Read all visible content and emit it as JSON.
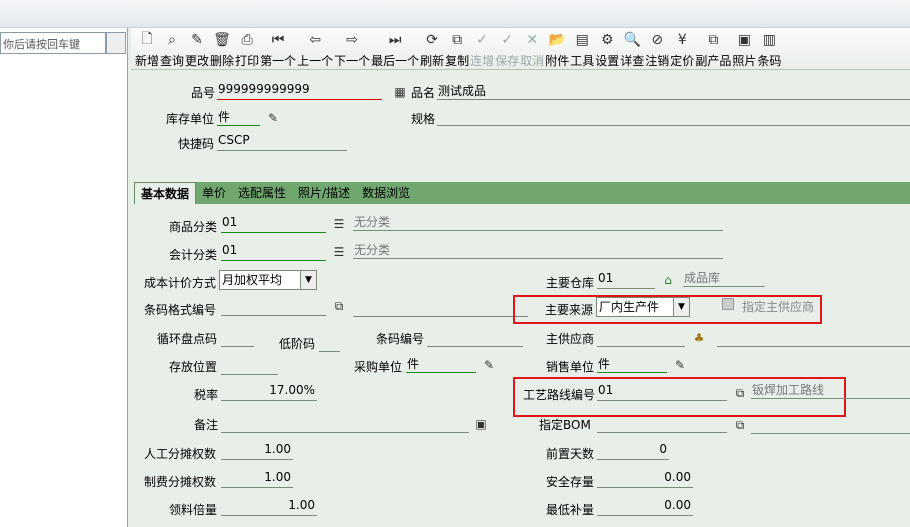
{
  "left_panel": {
    "search_placeholder": "你后请按回车键"
  },
  "toolbar": [
    {
      "label": "新增",
      "icon": "new-doc-icon",
      "glyph": "🗋"
    },
    {
      "label": "查询",
      "icon": "search-icon",
      "glyph": "⌕"
    },
    {
      "label": "更改",
      "icon": "pencil-icon",
      "glyph": "✎"
    },
    {
      "label": "删除",
      "icon": "trash-icon",
      "glyph": "🗑"
    },
    {
      "label": "打印",
      "icon": "printer-icon",
      "glyph": "⎙"
    },
    {
      "label": "第一个",
      "icon": "first-icon",
      "glyph": "⏮"
    },
    {
      "label": "上一个",
      "icon": "prev-icon",
      "glyph": "⇦"
    },
    {
      "label": "下一个",
      "icon": "next-icon",
      "glyph": "⇨"
    },
    {
      "label": "最后一个",
      "icon": "last-icon",
      "glyph": "⏭"
    },
    {
      "label": "刷新",
      "icon": "refresh-icon",
      "glyph": "⟳"
    },
    {
      "label": "复制",
      "icon": "copy-icon",
      "glyph": "⧉"
    },
    {
      "label": "连增",
      "icon": "continuous-add-icon",
      "glyph": "✓",
      "disabled": true
    },
    {
      "label": "保存",
      "icon": "save-icon",
      "glyph": "✓",
      "disabled": true
    },
    {
      "label": "取消",
      "icon": "cancel-icon",
      "glyph": "✕",
      "disabled": true
    },
    {
      "label": "附件",
      "icon": "folder-icon",
      "glyph": "📂"
    },
    {
      "label": "工具",
      "icon": "tools-icon",
      "glyph": "▤"
    },
    {
      "label": "设置",
      "icon": "gear-icon",
      "glyph": "⚙"
    },
    {
      "label": "详查",
      "icon": "detail-icon",
      "glyph": "🔍"
    },
    {
      "label": "注销",
      "icon": "logout-icon",
      "glyph": "⊘"
    },
    {
      "label": "定价",
      "icon": "price-icon",
      "glyph": "¥"
    },
    {
      "label": "副产品",
      "icon": "byproduct-icon",
      "glyph": "⧉"
    },
    {
      "label": "照片",
      "icon": "photo-icon",
      "glyph": "▣"
    },
    {
      "label": "条码",
      "icon": "barcode-icon",
      "glyph": "▥"
    }
  ],
  "header": {
    "item_no_label": "品号",
    "item_no": "999999999999",
    "item_name_label": "品名",
    "item_name": "测试成品",
    "unit_label": "库存单位",
    "unit": "件",
    "spec_label": "规格",
    "spec": "",
    "shortcode_label": "快捷码",
    "shortcode": "CSCP"
  },
  "tabs": [
    "基本数据",
    "单价",
    "选配属性",
    "照片/描述",
    "数据浏览"
  ],
  "basic": {
    "product_class_label": "商品分类",
    "product_class": "01",
    "product_class_desc": "无分类",
    "account_class_label": "会计分类",
    "account_class": "01",
    "account_class_desc": "无分类",
    "cost_method_label": "成本计价方式",
    "cost_method": "月加权平均",
    "main_wh_label": "主要仓库",
    "main_wh": "01",
    "main_wh_desc": "成品库",
    "barcode_fmt_label": "条码格式编号",
    "barcode_fmt": "",
    "main_source_label": "主要来源",
    "main_source": "厂内生产件",
    "designate_supplier_label": "指定主供应商",
    "cycle_count_label": "循环盘点码",
    "cycle_count": "",
    "low_level_label": "低阶码",
    "low_level": "",
    "barcode_no_label": "条码编号",
    "barcode_no": "",
    "main_supplier_label": "主供应商",
    "main_supplier": "",
    "location_label": "存放位置",
    "location": "",
    "purchase_unit_label": "采购单位",
    "purchase_unit": "件",
    "sales_unit_label": "销售单位",
    "sales_unit": "件",
    "tax_label": "税率",
    "tax": "17.00%",
    "routing_label": "工艺路线编号",
    "routing": "01",
    "routing_desc": "钣焊加工路线",
    "remark_label": "备注",
    "remark": "",
    "bom_label": "指定BOM",
    "bom": "",
    "labor_weight_label": "人工分摊权数",
    "labor_weight": "1.00",
    "lead_days_label": "前置天数",
    "lead_days": "0",
    "overhead_weight_label": "制费分摊权数",
    "overhead_weight": "1.00",
    "safety_stock_label": "安全存量",
    "safety_stock": "0.00",
    "issue_multiple_label": "领料倍量",
    "issue_multiple": "1.00",
    "min_replenish_label": "最低补量",
    "min_replenish": "0.00"
  }
}
